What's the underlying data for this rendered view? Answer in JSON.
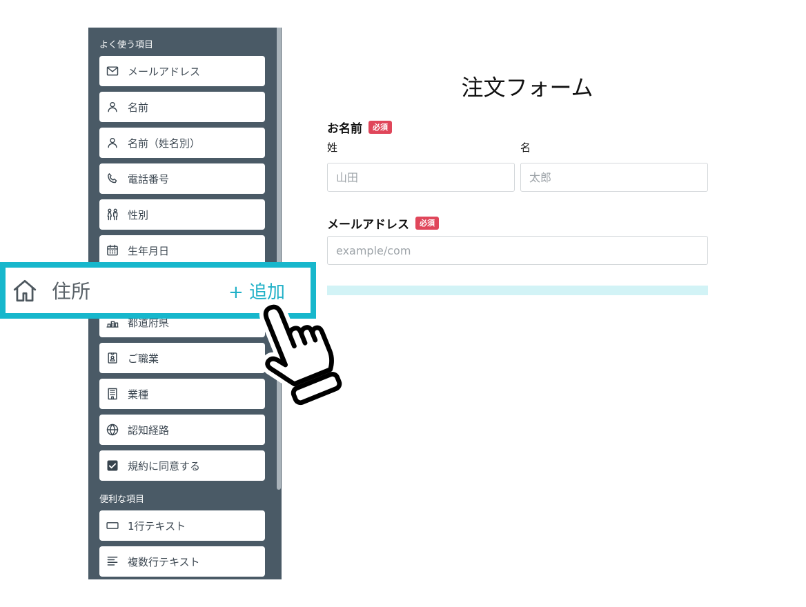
{
  "sidebar": {
    "sections": [
      {
        "title": "よく使う項目",
        "items": [
          {
            "label": "メールアドレス",
            "icon": "mail-icon"
          },
          {
            "label": "名前",
            "icon": "person-icon"
          },
          {
            "label": "名前（姓名別）",
            "icon": "person-icon"
          },
          {
            "label": "電話番号",
            "icon": "phone-icon"
          },
          {
            "label": "性別",
            "icon": "gender-icon"
          },
          {
            "label": "生年月日",
            "icon": "calendar-icon"
          },
          {
            "label": "都道府県",
            "icon": "prefecture-icon"
          },
          {
            "label": "ご職業",
            "icon": "id-badge-icon"
          },
          {
            "label": "業種",
            "icon": "building-icon"
          },
          {
            "label": "認知経路",
            "icon": "globe-icon"
          },
          {
            "label": "規約に同意する",
            "icon": "checkbox-checked-icon"
          }
        ]
      },
      {
        "title": "便利な項目",
        "items": [
          {
            "label": "1行テキスト",
            "icon": "single-line-text-icon"
          },
          {
            "label": "複数行テキスト",
            "icon": "multi-line-text-icon"
          }
        ]
      }
    ]
  },
  "dragging_item": {
    "label": "住所",
    "icon": "home-icon",
    "add_label": "+ 追加",
    "cursor_icon": "hand-pointer-icon"
  },
  "form": {
    "title": "注文フォーム",
    "name": {
      "label": "お名前",
      "required_badge": "必須",
      "last_name_label": "姓",
      "first_name_label": "名",
      "last_name_placeholder": "山田",
      "first_name_placeholder": "太郎"
    },
    "email": {
      "label": "メールアドレス",
      "required_badge": "必須",
      "placeholder": "example/com"
    }
  },
  "colors": {
    "sidebar_bg": "#4a5a66",
    "accent": "#17b7cc",
    "required_badge": "#e0465a",
    "drop_indicator": "#d2f3f6"
  }
}
